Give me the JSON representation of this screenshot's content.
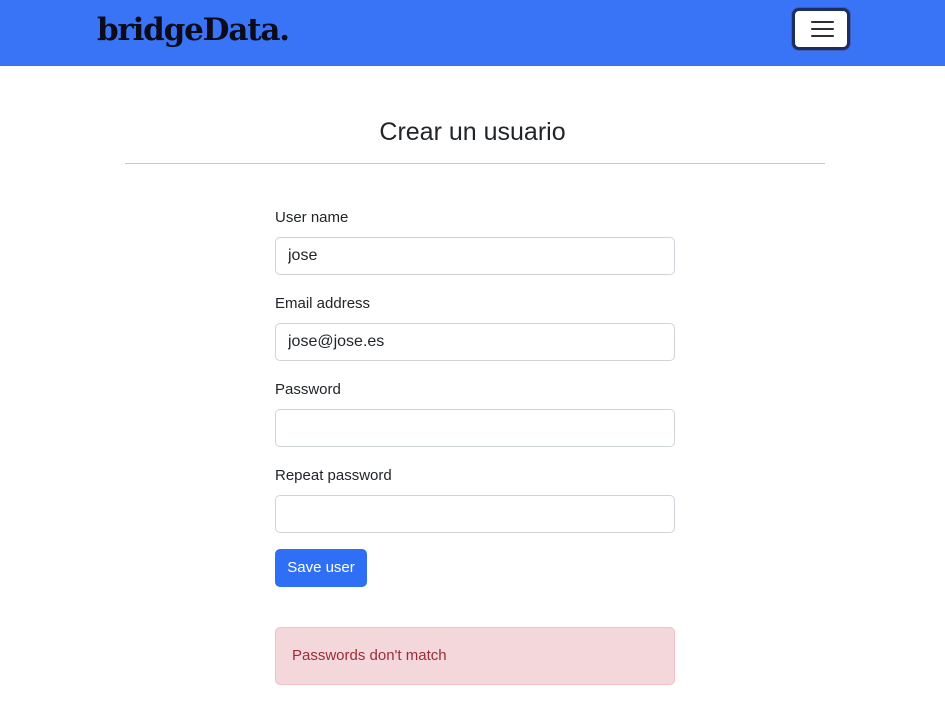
{
  "navbar": {
    "brand": "bridgeData.",
    "toggler_icon": "hamburger-menu-icon",
    "background_color": "#3874f5"
  },
  "page": {
    "title": "Crear un usuario"
  },
  "form": {
    "username": {
      "label": "User name",
      "value": "jose"
    },
    "email": {
      "label": "Email address",
      "value": "jose@jose.es"
    },
    "password": {
      "label": "Password",
      "value": ""
    },
    "repeat_password": {
      "label": "Repeat password",
      "value": ""
    },
    "save_label": "Save user",
    "button_color": "#2f6ff5"
  },
  "alert": {
    "message": "Passwords don't match",
    "type": "danger"
  }
}
